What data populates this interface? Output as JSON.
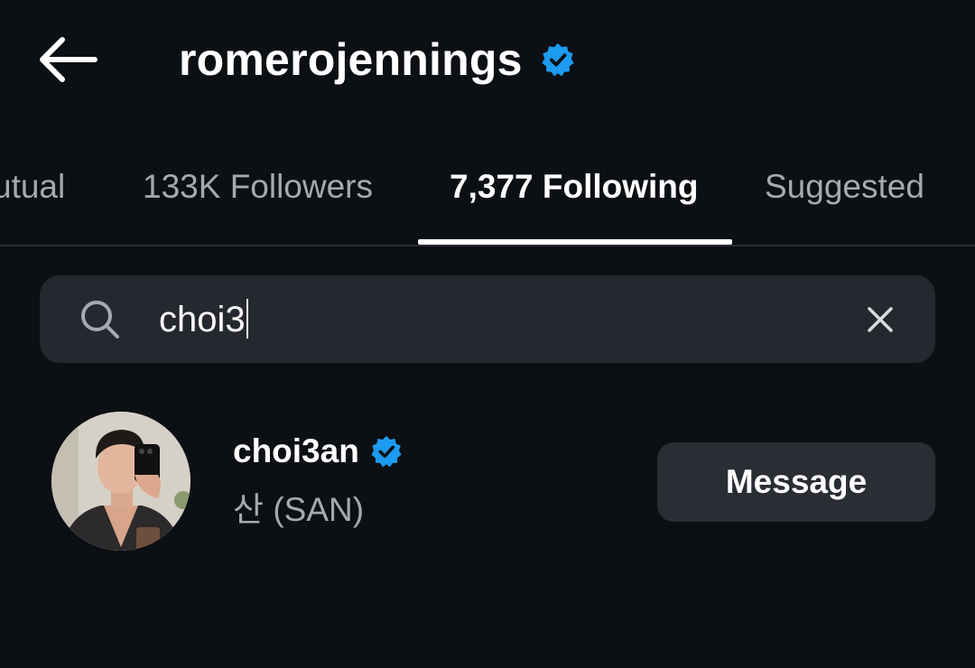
{
  "header": {
    "back_icon": "arrow-left-icon",
    "title": "romerojennings",
    "verified_icon": "verified-badge-icon",
    "accent_color": "#1d9bf0"
  },
  "tabs": [
    {
      "label": "Mutual",
      "visible_text": "utual",
      "active": false
    },
    {
      "label": "133K Followers",
      "active": false
    },
    {
      "label": "7,377 Following",
      "active": true
    },
    {
      "label": "Suggested",
      "active": false
    }
  ],
  "search": {
    "icon": "search-icon",
    "value": "choi3",
    "clear_icon": "close-icon"
  },
  "results": [
    {
      "username": "choi3an",
      "verified": true,
      "full_name": "산 (SAN)",
      "action_label": "Message"
    }
  ],
  "colors": {
    "background": "#0c0f14",
    "surface": "#25282e",
    "muted_text": "#a6a9b0",
    "verified_blue": "#1d9bf0"
  }
}
